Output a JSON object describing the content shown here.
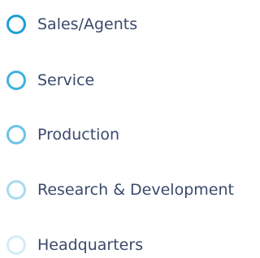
{
  "legend": {
    "items": [
      {
        "label": "Sales/Agents",
        "color": "#1a9fd6"
      },
      {
        "label": "Service",
        "color": "#3fb1dd"
      },
      {
        "label": "Production",
        "color": "#6cc3e6"
      },
      {
        "label": "Research & Development",
        "color": "#a6dbf0"
      },
      {
        "label": "Headquarters",
        "color": "#d3edf8"
      }
    ]
  }
}
